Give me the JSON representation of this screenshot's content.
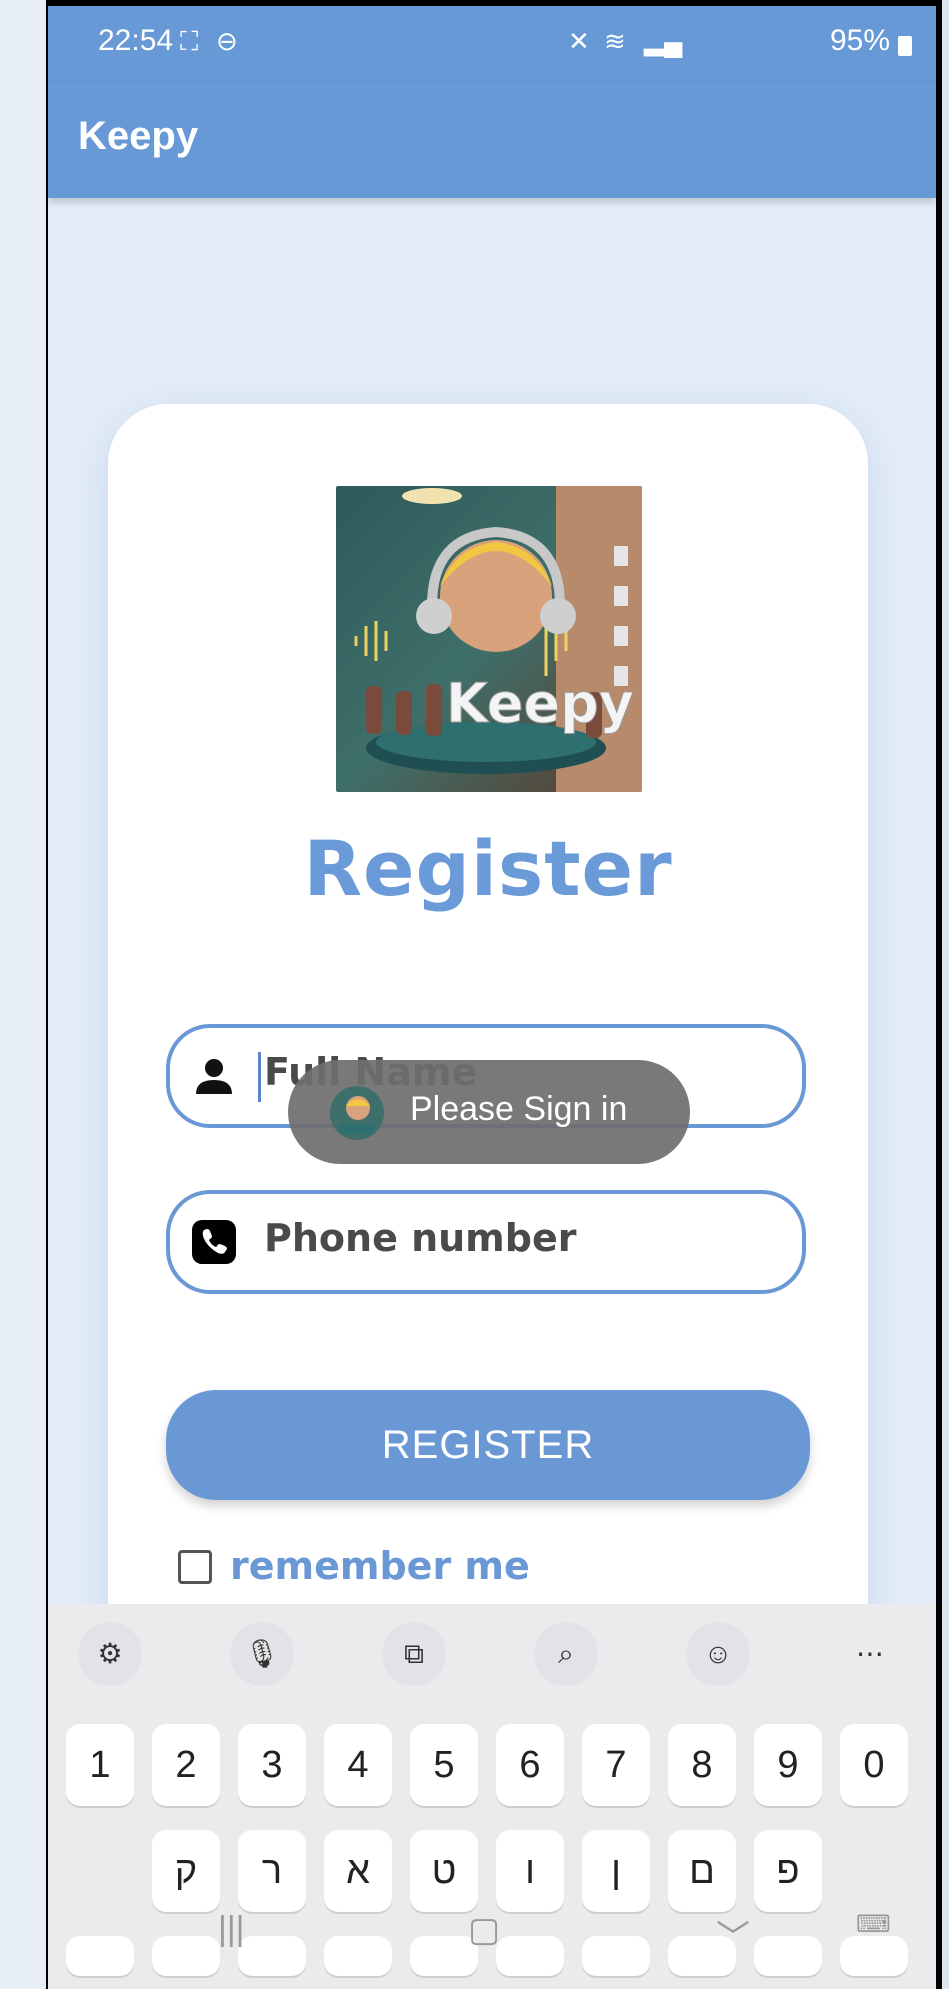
{
  "status_bar": {
    "time": "22:54",
    "battery": "95%"
  },
  "app_bar": {
    "title": "Keepy"
  },
  "logo": {
    "text": "Keepy"
  },
  "form": {
    "title": "Register",
    "name_placeholder": "Full Name",
    "phone_placeholder": "Phone number",
    "register_button": "REGISTER",
    "remember_label": "remember me"
  },
  "toast": {
    "text": "Please Sign in"
  },
  "keyboard": {
    "toolbar": [
      "settings-icon",
      "mic-icon",
      "translate-icon",
      "search-icon",
      "emoji-icon",
      "more-icon"
    ],
    "row_numbers": [
      "1",
      "2",
      "3",
      "4",
      "5",
      "6",
      "7",
      "8",
      "9",
      "0"
    ],
    "row_hebrew": [
      "ק",
      "ר",
      "א",
      "ט",
      "ו",
      "ן",
      "ם",
      "פ"
    ]
  },
  "colors": {
    "accent": "#6a98d4",
    "appbar": "#6699d6"
  }
}
